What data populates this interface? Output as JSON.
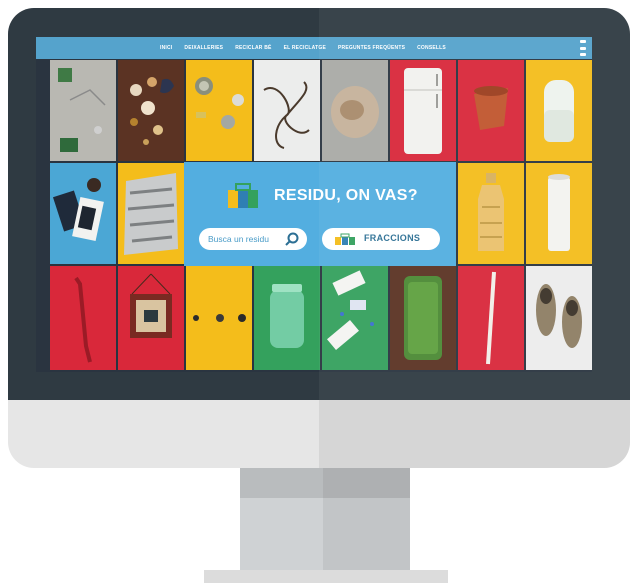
{
  "nav": {
    "items": [
      {
        "label": "INICI"
      },
      {
        "label": "DEIXALLERIES"
      },
      {
        "label": "RECICLAR BÉ"
      },
      {
        "label": "EL RECICLATGE"
      },
      {
        "label": "PREGUNTES FREQÜENTS"
      },
      {
        "label": "CONSELLS"
      }
    ]
  },
  "hero": {
    "title": "RESIDU, ON VAS?",
    "search_placeholder": "Busca un residu",
    "fractions_label": "FRACCIONS"
  },
  "tiles": [
    {
      "name": "tile-electronics",
      "color": "grey"
    },
    {
      "name": "tile-food-scraps",
      "color": "brown"
    },
    {
      "name": "tile-bottle-caps",
      "color": "yellow"
    },
    {
      "name": "tile-string",
      "color": "white"
    },
    {
      "name": "tile-sawdust",
      "color": "grey"
    },
    {
      "name": "tile-fridge",
      "color": "red"
    },
    {
      "name": "tile-flowerpot",
      "color": "red"
    },
    {
      "name": "tile-lamp",
      "color": "yellow"
    },
    {
      "name": "tile-magazines",
      "color": "blue"
    },
    {
      "name": "tile-aluminium-foil",
      "color": "yellow"
    },
    {
      "name": "tile-plastic-bottle",
      "color": "yellow"
    },
    {
      "name": "tile-paper-roll",
      "color": "yellow"
    },
    {
      "name": "tile-straw",
      "color": "red"
    },
    {
      "name": "tile-picture-frame",
      "color": "red"
    },
    {
      "name": "tile-batteries",
      "color": "yellow"
    },
    {
      "name": "tile-glass-jar",
      "color": "green"
    },
    {
      "name": "tile-medicine",
      "color": "green"
    },
    {
      "name": "tile-grass",
      "color": "brown"
    },
    {
      "name": "tile-stick",
      "color": "red"
    },
    {
      "name": "tile-shoes",
      "color": "white"
    }
  ]
}
